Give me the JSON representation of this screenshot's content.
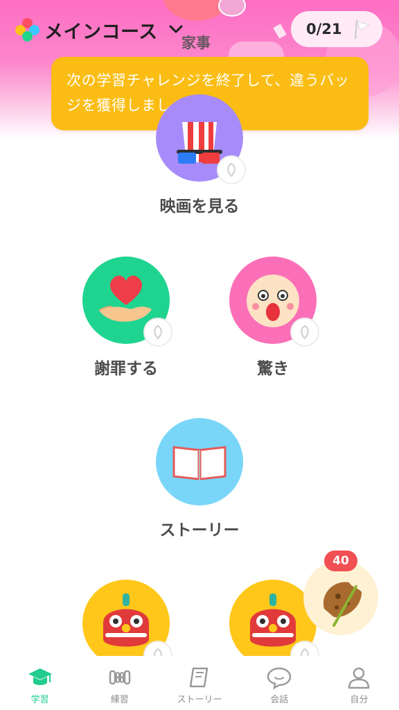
{
  "header": {
    "course_title": "メインコース",
    "section_peek": "家事",
    "progress": "0/21"
  },
  "tooltip": {
    "text": "次の学習チャレンジを終了して、違うバッジを獲得しましょう！"
  },
  "lessons": [
    {
      "label": "映画を見る",
      "icon": "popcorn-3d-glasses-icon",
      "color": "#a78bfa"
    },
    {
      "label": "謝罪する",
      "icon": "heart-in-hand-icon",
      "color": "#1fd48f"
    },
    {
      "label": "驚き",
      "icon": "surprised-face-icon",
      "color": "#fb6fb8"
    },
    {
      "label": "ストーリー",
      "icon": "open-book-icon",
      "color": "#79d6f8"
    },
    {
      "label": "",
      "icon": "lion-dance-icon",
      "color": "#ffc71a"
    },
    {
      "label": "",
      "icon": "lion-dance-icon",
      "color": "#ffc71a"
    }
  ],
  "fab": {
    "count": "40",
    "icon": "cookie-stick-icon"
  },
  "tabs": [
    {
      "label": "学習",
      "icon": "graduation-cap-icon",
      "active": true
    },
    {
      "label": "練習",
      "icon": "dumbbell-icon",
      "active": false
    },
    {
      "label": "ストーリー",
      "icon": "book-icon",
      "active": false
    },
    {
      "label": "会話",
      "icon": "chat-bubble-icon",
      "active": false
    },
    {
      "label": "自分",
      "icon": "person-icon",
      "active": false
    }
  ],
  "colors": {
    "accent": "#22cc8f",
    "tooltip": "#fbbd14",
    "header": "#fd6ec2"
  }
}
